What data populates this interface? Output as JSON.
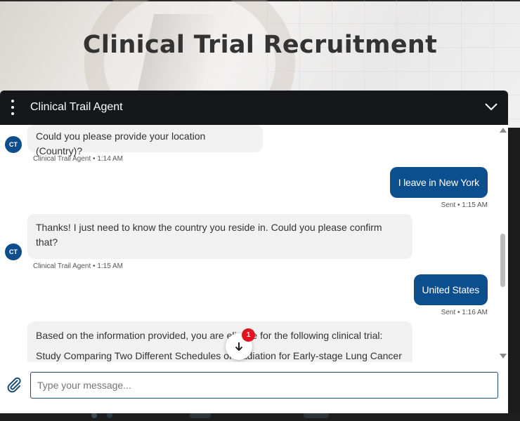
{
  "page": {
    "title": "Clinical Trial Recruitment"
  },
  "chat": {
    "header_title": "Clinical Trail Agent",
    "messages": [
      {
        "sender": "agent",
        "avatar": "CT",
        "text": "Could you please provide your location (Country)?",
        "meta": "Clinical Trail Agent • 1:14 AM"
      },
      {
        "sender": "user",
        "text": "I leave in New York",
        "meta": "Sent • 1:15 AM"
      },
      {
        "sender": "agent",
        "avatar": "CT",
        "text": "Thanks! I just need to know the country you reside in. Could you please confirm that?",
        "meta": "Clinical Trail Agent • 1:15 AM"
      },
      {
        "sender": "user",
        "text": "United States",
        "meta": "Sent • 1:16 AM"
      },
      {
        "sender": "agent",
        "text_line1": "Based on the information provided, you are eligible for the following clinical trial:",
        "text_line2": "Study Comparing Two Different Schedules of Radiation for Early-stage Lung Cancer"
      }
    ],
    "new_message_count": "1",
    "input_placeholder": "Type your message...",
    "colors": {
      "header_bg": "#16171b",
      "user_bubble": "#0b4f8f",
      "agent_bubble": "#f1f1f1",
      "avatar_bg": "#0e4d8c",
      "badge": "#e0141e"
    },
    "icons": {
      "menu": "kebab-menu-icon",
      "collapse": "chevron-down-icon",
      "scroll_to_bottom": "arrow-down-icon",
      "attach": "paperclip-icon"
    }
  }
}
